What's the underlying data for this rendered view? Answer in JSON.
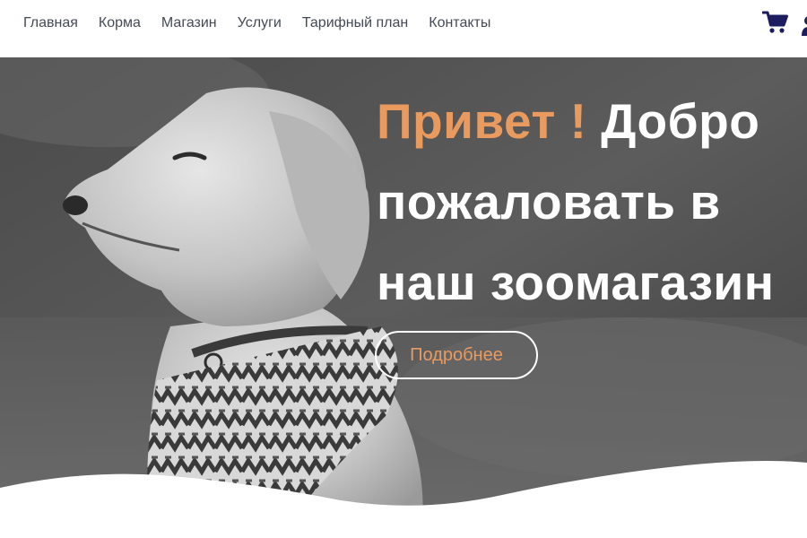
{
  "nav": {
    "items": [
      {
        "label": "Главная"
      },
      {
        "label": "Корма"
      },
      {
        "label": "Магазин"
      },
      {
        "label": "Услуги"
      },
      {
        "label": "Тарифный план"
      },
      {
        "label": "Контакты"
      }
    ]
  },
  "header_icons": {
    "cart": "shopping-cart-icon",
    "user": "user-icon",
    "icon_color": "#1c1c5e"
  },
  "hero": {
    "title_accent": "Привет !",
    "title_line1_rest": "Добро",
    "title_line2": "пожаловать в",
    "title_line3": "наш зоомагазин",
    "button_label": "Подробнее",
    "accent_color": "#e99a5e"
  }
}
